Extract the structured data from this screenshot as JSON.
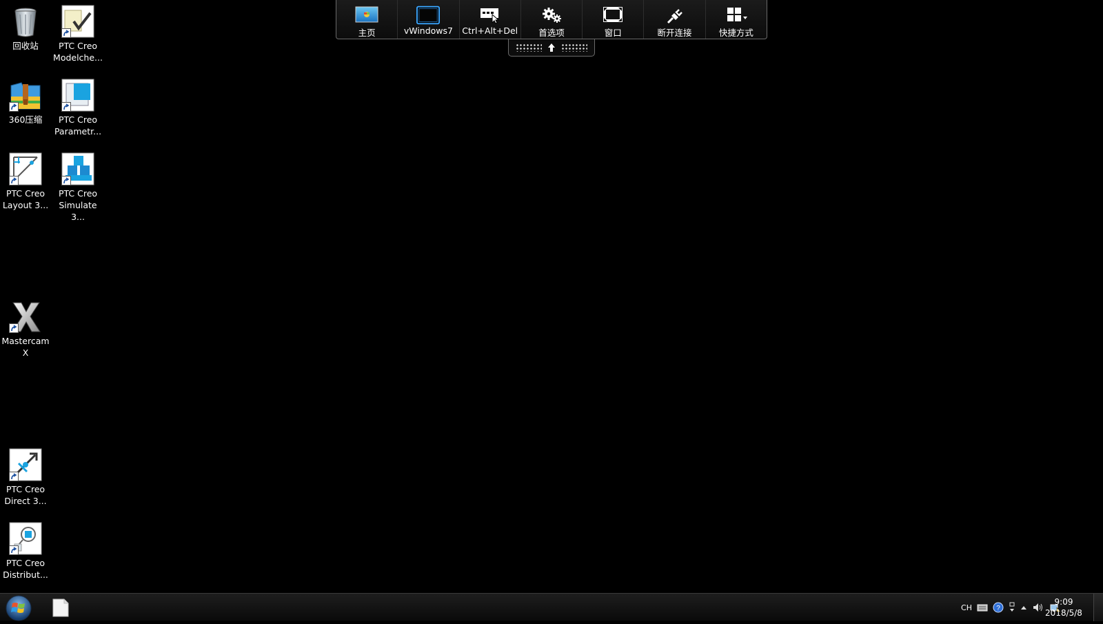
{
  "desktop": {
    "icons": {
      "recycle_bin": "回收站",
      "modelcheck": "PTC Creo Modelche...",
      "zip360": "360压缩",
      "parametric": "PTC Creo Parametr...",
      "layout": "PTC Creo Layout 3...",
      "simulate": "PTC Creo Simulate 3...",
      "mastercam": "Mastercam X",
      "direct": "PTC Creo Direct 3...",
      "distribute": "PTC Creo Distribut..."
    }
  },
  "toolbar": {
    "home": "主页",
    "vm": "vWindows7",
    "cad": "Ctrl+Alt+Del",
    "prefs": "首选项",
    "window": "窗口",
    "disconnect": "断开连接",
    "shortcuts": "快捷方式"
  },
  "taskbar": {
    "tray": {
      "lang": "CH"
    },
    "clock": {
      "time": "9:09",
      "date": "2018/5/8"
    }
  },
  "icon_names": [
    "recycle-bin-icon",
    "modelcheck-icon",
    "zip-archive-icon",
    "parametric-icon",
    "layout-icon",
    "simulate-icon",
    "mastercam-icon",
    "direct-icon",
    "distribute-icon",
    "monitor-icon",
    "keyboard-icon",
    "gear-icon",
    "window-icon",
    "plug-icon",
    "grid-icon",
    "windows-logo-icon",
    "document-icon",
    "help-icon",
    "speaker-icon",
    "network-icon"
  ]
}
